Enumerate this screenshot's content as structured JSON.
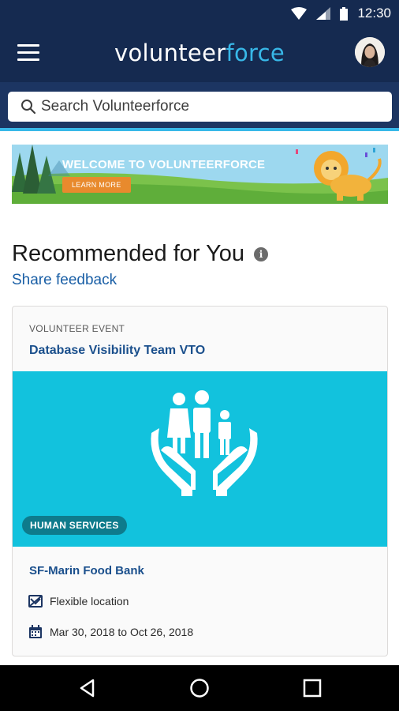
{
  "status_bar": {
    "time": "12:30"
  },
  "app_bar": {
    "brand_part1": "volunteer",
    "brand_part2": "force"
  },
  "search": {
    "placeholder": "Search Volunteerforce"
  },
  "banner": {
    "title": "WELCOME TO VOLUNTEERFORCE",
    "button": "LEARN MORE"
  },
  "recommended": {
    "title": "Recommended for You",
    "info_icon_glyph": "i",
    "feedback_link": "Share feedback"
  },
  "card": {
    "kind": "VOLUNTEER EVENT",
    "title": "Database Visibility Team VTO",
    "category": "HUMAN SERVICES",
    "organization": "SF-Marin Food Bank",
    "location": "Flexible location",
    "dates": "Mar 30, 2018 to Oct 26, 2018"
  },
  "colors": {
    "primary_dark": "#152a50",
    "accent": "#38b8e8",
    "hero_bg": "#12c2dd",
    "link": "#1a4f8c"
  },
  "icons": [
    "wifi-icon",
    "signal-icon",
    "battery-icon",
    "hamburger-icon",
    "search-icon",
    "info-icon",
    "location-icon",
    "calendar-icon",
    "back-icon",
    "home-icon",
    "recents-icon"
  ]
}
